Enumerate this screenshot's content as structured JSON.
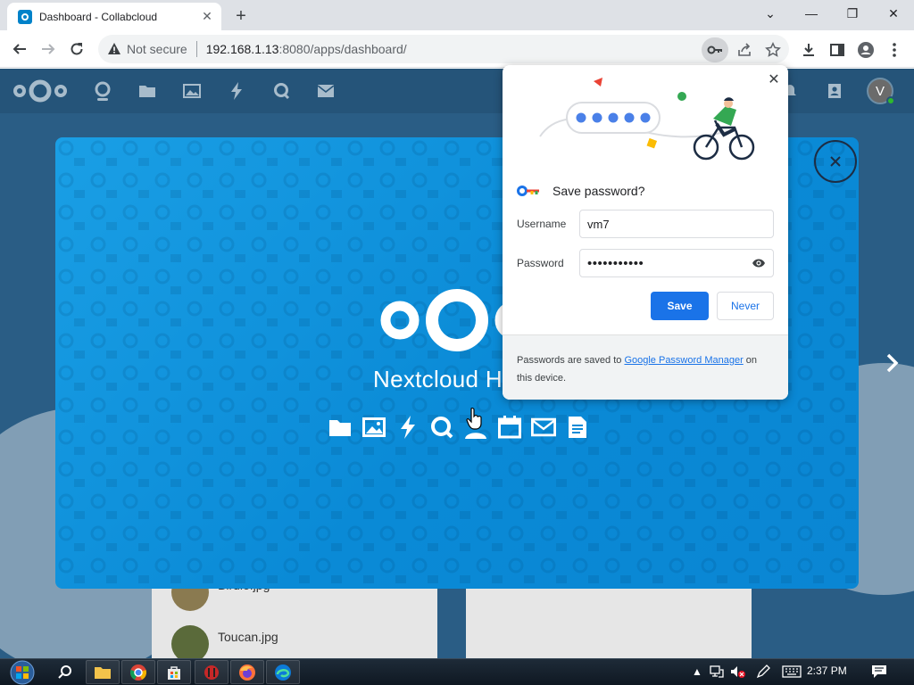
{
  "browser": {
    "tab": {
      "title": "Dashboard - Collabcloud",
      "close": "✕"
    },
    "new_tab": "+",
    "window_controls": {
      "dropdown": "⌄",
      "minimize": "—",
      "maximize": "❐",
      "close": "✕"
    },
    "security_text": "Not secure",
    "url_host": "192.168.1.13",
    "url_rest": ":8080/apps/dashboard/"
  },
  "nextcloud": {
    "avatar_letter": "V",
    "modal": {
      "title": "Nextcloud H",
      "close_icon": "close-icon",
      "feature_icons": [
        "folder-icon",
        "image-icon",
        "activity-icon",
        "talk-icon",
        "contacts-icon",
        "calendar-icon",
        "mail-icon",
        "notes-icon"
      ]
    },
    "dashboard": {
      "files": [
        "Birdie.jpg",
        "Toucan.jpg"
      ]
    }
  },
  "password_bubble": {
    "title": "Save password?",
    "username_label": "Username",
    "username_value": "vm7",
    "password_label": "Password",
    "password_value": "•••••••••••",
    "save_label": "Save",
    "never_label": "Never",
    "footer_pre": "Passwords are saved to ",
    "footer_link": "Google Password Manager",
    "footer_post": " on this device."
  },
  "taskbar": {
    "time": "2:37 PM"
  },
  "colors": {
    "chrome_blue": "#1a73e8",
    "nextcloud_blue": "#0082c9",
    "header": "#255479"
  }
}
